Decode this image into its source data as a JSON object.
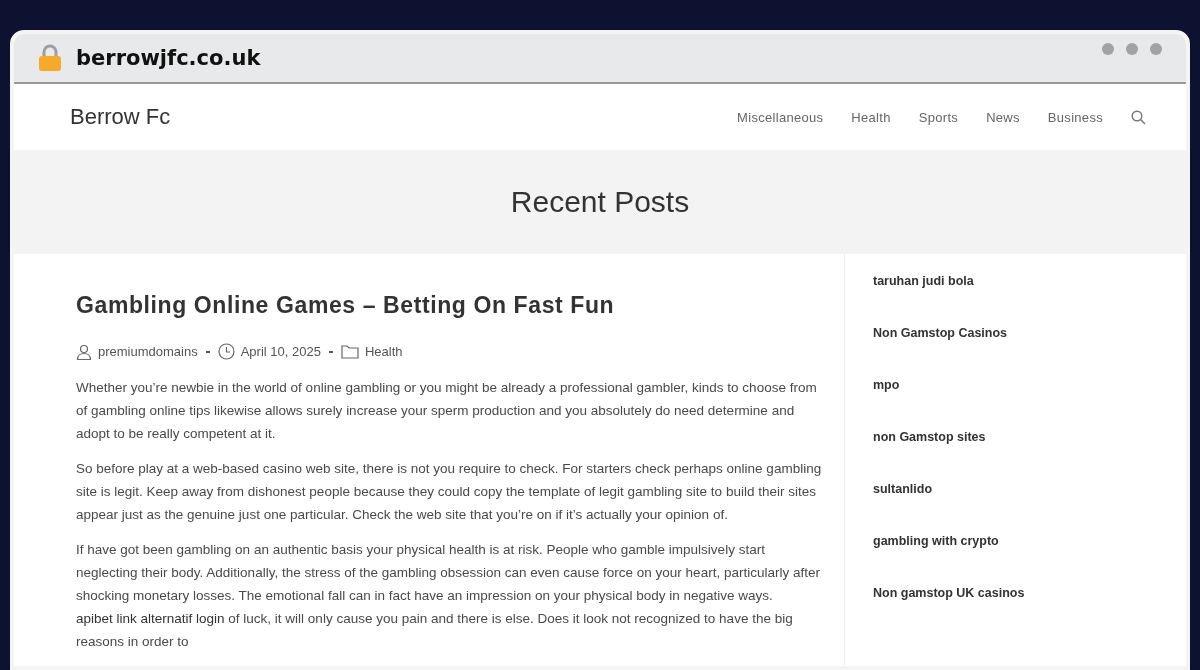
{
  "browser": {
    "url": "berrowjfc.co.uk"
  },
  "site": {
    "title": "Berrow Fc",
    "nav": [
      {
        "label": "Miscellaneous"
      },
      {
        "label": "Health"
      },
      {
        "label": "Sports"
      },
      {
        "label": "News"
      },
      {
        "label": "Business"
      }
    ]
  },
  "hero": {
    "title": "Recent Posts"
  },
  "post": {
    "title": "Gambling Online Games – Betting On Fast Fun",
    "author": "premiumdomains",
    "date": "April 10, 2025",
    "category": "Health",
    "paragraphs": [
      [
        {
          "kind": "text",
          "text": "Whether you’re newbie in the world of online gambling or you might be already a professional gambler, kinds to choose from of gambling online tips likewise allows surely increase your sperm production and you absolutely do need determine and adopt to be really competent at it."
        }
      ],
      [
        {
          "kind": "text",
          "text": "So before play at a web-based casino web site, there is not you require to check. For starters check perhaps online gambling site is legit. Keep away from dishonest people because they could copy the template of legit gambling site to build their sites appear just as the genuine just one particular. Check the web site that you’re on if it’s actually your opinion of."
        }
      ],
      [
        {
          "kind": "text",
          "text": "If have got been gambling on an authentic basis your physical health is at risk. People who gamble impulsively start neglecting their body. Additionally, the stress of the gambling obsession can even cause force on your heart, particularly after shocking monetary losses. The emotional fall can in fact have an impression on your physical body in negative ways. "
        },
        {
          "kind": "link",
          "text": "apibet link alternatif login"
        },
        {
          "kind": "text",
          "text": " of luck, it will only cause you pain and there is else. Does it look not recognized to have the big reasons in order to"
        }
      ]
    ]
  },
  "sidebar": {
    "links": [
      {
        "label": "taruhan judi bola"
      },
      {
        "label": "Non Gamstop Casinos"
      },
      {
        "label": "mpo"
      },
      {
        "label": "non Gamstop sites"
      },
      {
        "label": "sultanlido"
      },
      {
        "label": "gambling with crypto"
      },
      {
        "label": "Non gamstop UK casinos"
      }
    ]
  }
}
